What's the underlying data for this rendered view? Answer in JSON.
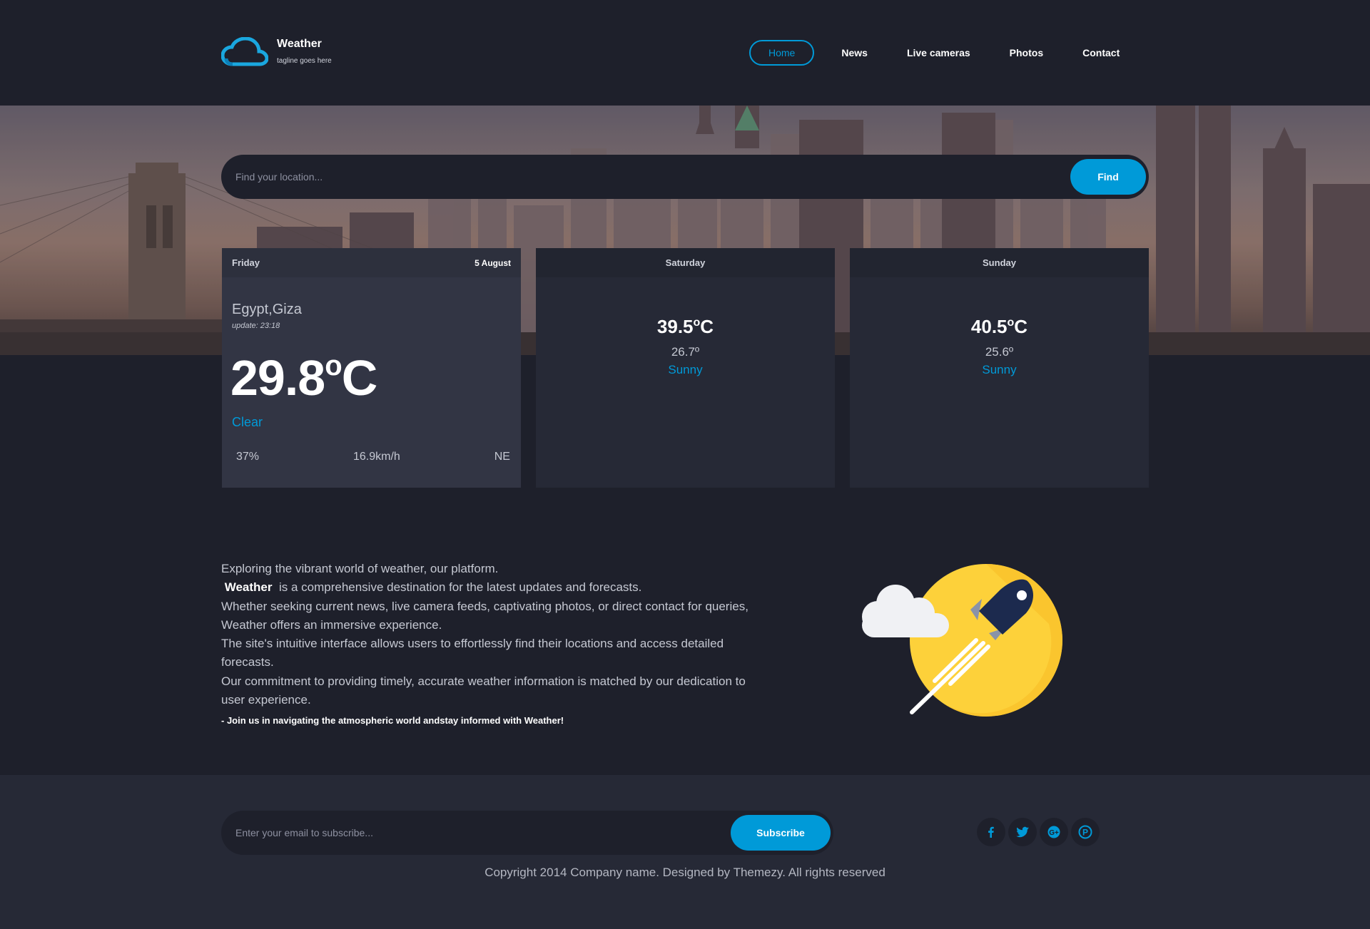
{
  "brand": {
    "title": "Weather",
    "tagline": "tagline goes here",
    "logo_icon": "cloud-icon"
  },
  "nav": {
    "items": [
      {
        "label": "Home",
        "active": true
      },
      {
        "label": "News"
      },
      {
        "label": "Live cameras"
      },
      {
        "label": "Photos"
      },
      {
        "label": "Contact"
      }
    ]
  },
  "search": {
    "placeholder": "Find your location...",
    "button": "Find"
  },
  "today": {
    "day": "Friday",
    "date": "5 August",
    "location": "Egypt,Giza",
    "update": "update: 23:18",
    "temp": "29.8",
    "temp_unit": "o",
    "temp_scale": "C",
    "condition": "Clear",
    "humidity": "37%",
    "wind_speed": "16.9km/h",
    "wind_dir": "NE"
  },
  "forecast": [
    {
      "day": "Saturday",
      "high": "39.5",
      "deg": "o",
      "scale": "C",
      "low": "26.7º",
      "condition": "Sunny"
    },
    {
      "day": "Sunday",
      "high": "40.5",
      "deg": "o",
      "scale": "C",
      "low": "25.6º",
      "condition": "Sunny"
    }
  ],
  "about": {
    "line1": "Exploring the vibrant world of weather, our platform.",
    "brand_word": "Weather",
    "line2": "is a comprehensive destination for the latest updates and forecasts.",
    "line3": "Whether seeking current news, live camera feeds, captivating photos, or direct contact for queries, Weather offers an immersive experience.",
    "line4": "The site's intuitive interface allows users to effortlessly find their locations and access detailed forecasts.",
    "line5": "Our commitment to providing timely, accurate weather information is matched by our dedication to user experience.",
    "join": "- Join us in navigating the atmospheric world andstay informed with Weather!"
  },
  "footer": {
    "email_placeholder": "Enter your email to subscribe...",
    "subscribe": "Subscribe",
    "socials": [
      "facebook-icon",
      "twitter-icon",
      "google-plus-icon",
      "pinterest-icon"
    ],
    "copyright": "Copyright 2014 Company name. Designed by Themezy. All rights reserved"
  },
  "colors": {
    "accent": "#009ad8",
    "background": "#1e202b",
    "card": "#323544",
    "footer": "#262936"
  }
}
